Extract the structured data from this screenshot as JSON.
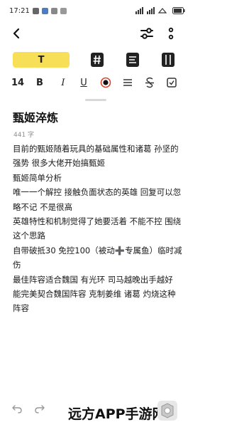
{
  "status_bar": {
    "time": "17:21",
    "right_text": "4G 4G 5",
    "battery_label": "89"
  },
  "toolbar": {
    "back_icon": "back-arrow-icon",
    "share_icon": "share-settings-icon",
    "more_icon": "more-vertical-icon"
  },
  "format_row1": {
    "text_style_label": "T",
    "icons": [
      "hashtag-icon",
      "list-doc-icon",
      "book-icon"
    ]
  },
  "format_row2": {
    "font_size": "14",
    "bold": "B",
    "italic": "I",
    "underline": "U",
    "icons": [
      "color-picker-icon",
      "align-icon",
      "strikethrough-icon",
      "checkbox-icon"
    ]
  },
  "document": {
    "title": "甄姬淬炼",
    "char_count": "441 字",
    "lines": [
      "目前的甄姬随着玩具的基础属性和诸葛 孙坚的强势 很多大佬开始搞甄姬",
      "甄姬简单分析",
      "唯一一个解控 接触负面状态的英雄 回复可以忽略不记  不是很高",
      "英雄特性和机制觉得了她要活着  不能不控 围绕这个思路",
      "自带破抵30 免控100（被动➕专属鱼）临时减伤",
      "最佳阵容适合魏国 有光环  司马越晚出手越好 能完美契合魏国阵容  克制姜维 诸葛 灼烧这种阵容"
    ]
  },
  "bottom_bar": {
    "watermark_text": "远方APP手游网"
  },
  "colors": {
    "accent_yellow": "#f7df58"
  }
}
